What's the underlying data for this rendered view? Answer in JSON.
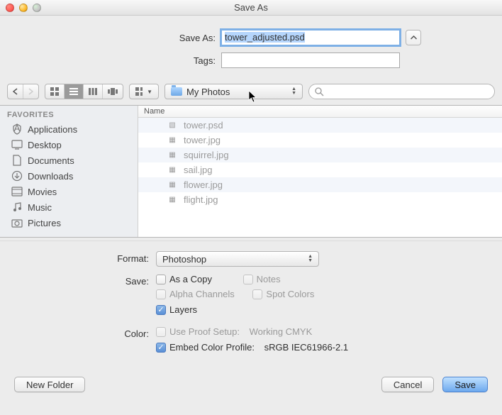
{
  "window": {
    "title": "Save As"
  },
  "fields": {
    "saveas_label": "Save As:",
    "saveas_value": "tower_adjusted.psd",
    "tags_label": "Tags:",
    "tags_value": ""
  },
  "toolbar": {
    "folder_label": "My Photos",
    "search_placeholder": ""
  },
  "sidebar": {
    "header": "FAVORITES",
    "items": [
      {
        "label": "Applications",
        "icon": "app-icon"
      },
      {
        "label": "Desktop",
        "icon": "desktop-icon"
      },
      {
        "label": "Documents",
        "icon": "documents-icon"
      },
      {
        "label": "Downloads",
        "icon": "downloads-icon"
      },
      {
        "label": "Movies",
        "icon": "movies-icon"
      },
      {
        "label": "Music",
        "icon": "music-icon"
      },
      {
        "label": "Pictures",
        "icon": "pictures-icon"
      }
    ]
  },
  "filelist": {
    "column_name": "Name",
    "files": [
      {
        "name": "tower.psd",
        "icon": "psd"
      },
      {
        "name": "tower.jpg",
        "icon": "jpg"
      },
      {
        "name": "squirrel.jpg",
        "icon": "jpg"
      },
      {
        "name": "sail.jpg",
        "icon": "jpg"
      },
      {
        "name": "flower.jpg",
        "icon": "jpg"
      },
      {
        "name": "flight.jpg",
        "icon": "jpg"
      }
    ]
  },
  "options": {
    "format_label": "Format:",
    "format_value": "Photoshop",
    "save_label": "Save:",
    "as_copy": "As a Copy",
    "notes": "Notes",
    "alpha": "Alpha Channels",
    "spot": "Spot Colors",
    "layers": "Layers",
    "color_label": "Color:",
    "use_proof": "Use Proof Setup:",
    "proof_value": "Working CMYK",
    "embed_profile": "Embed Color Profile:",
    "profile_value": "sRGB IEC61966-2.1"
  },
  "buttons": {
    "new_folder": "New Folder",
    "cancel": "Cancel",
    "save": "Save"
  }
}
